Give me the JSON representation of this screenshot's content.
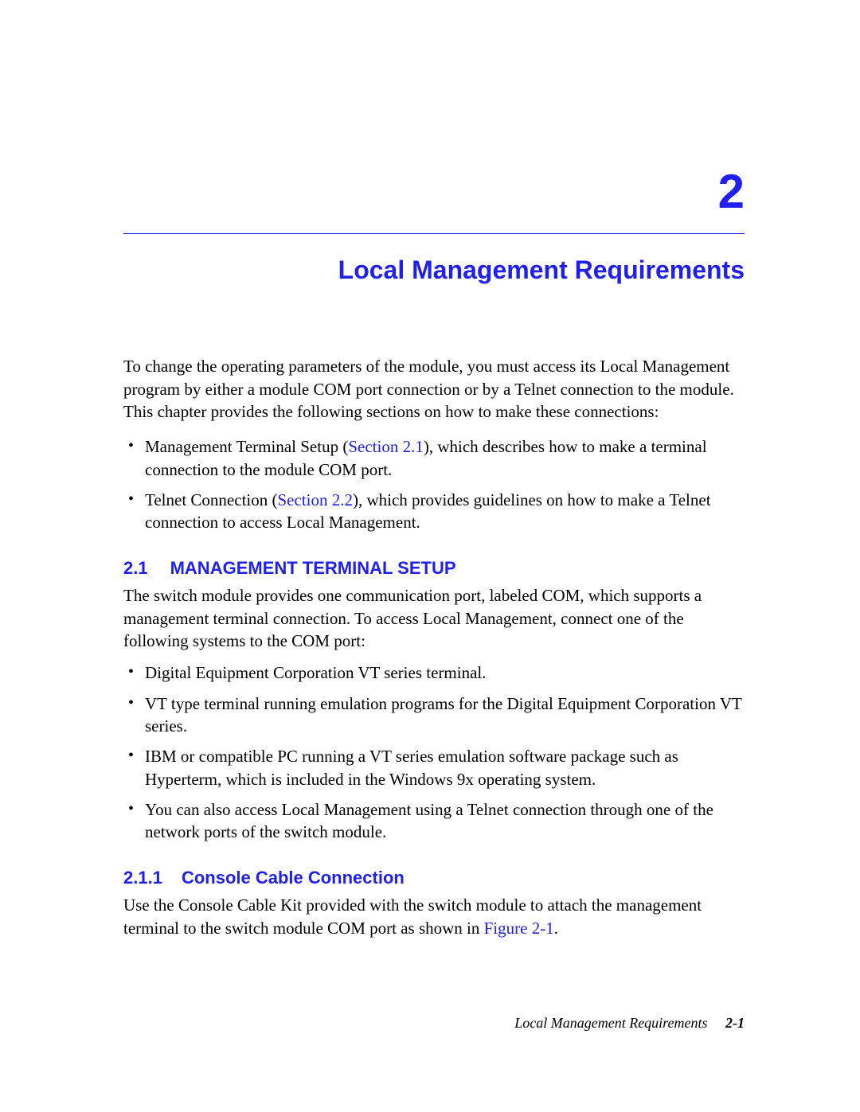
{
  "chapter": {
    "number": "2",
    "title": "Local Management Requirements"
  },
  "intro": "To change the operating parameters of the module, you must access its Local Management program by either a module COM port connection or by a Telnet connection to the module. This chapter provides the following sections on how to make these connections:",
  "intro_bullets": {
    "b1_a": "Management Terminal Setup (",
    "b1_link": "Section 2.1",
    "b1_b": "), which describes how to make a terminal connection to the module COM port.",
    "b2_a": "Telnet Connection (",
    "b2_link": "Section 2.2",
    "b2_b": "), which provides guidelines on how to make a Telnet connection to access Local Management."
  },
  "section21": {
    "num": "2.1",
    "title": "MANAGEMENT TERMINAL SETUP",
    "para": "The switch module provides one communication port, labeled COM, which supports a management terminal connection. To access Local Management, connect one of the following systems to the COM port:",
    "bullets": [
      "Digital Equipment Corporation VT series terminal.",
      "VT type terminal running emulation programs for the Digital Equipment Corporation VT series.",
      "IBM or compatible PC running a VT series emulation software package such as Hyperterm, which is included in the Windows 9x operating system.",
      "You can also access Local Management using a Telnet connection through one of the network ports of the switch module."
    ]
  },
  "section211": {
    "num": "2.1.1",
    "title": "Console Cable Connection",
    "para_a": "Use the Console Cable Kit provided with the switch module to attach the management terminal to the switch module COM port as shown in ",
    "para_link": "Figure 2-1",
    "para_b": "."
  },
  "footer": {
    "title": "Local Management Requirements",
    "page": "2-1"
  }
}
